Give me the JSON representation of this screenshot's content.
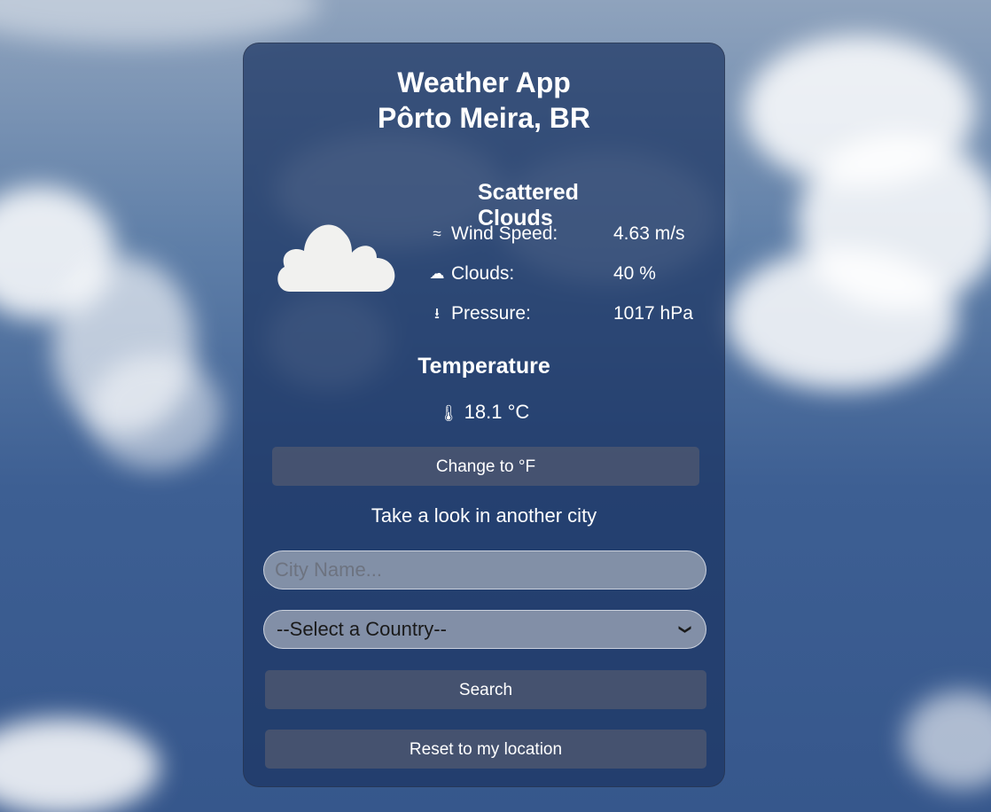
{
  "app": {
    "title": "Weather App",
    "location": "Pôrto Meira, BR"
  },
  "weather": {
    "description": "Scattered Clouds",
    "icon": "scattered-clouds-icon",
    "stats": [
      {
        "icon": "wind-icon",
        "glyph": "≈",
        "label": "Wind Speed:",
        "value": "4.63 m/s"
      },
      {
        "icon": "cloud-icon",
        "glyph": "☁",
        "label": "Clouds:",
        "value": "40 %"
      },
      {
        "icon": "pressure-icon",
        "glyph": "⭳",
        "label": "Pressure:",
        "value": "1017 hPa"
      }
    ]
  },
  "temperature": {
    "title": "Temperature",
    "icon": "thermometer-icon",
    "glyph": "🌡",
    "value": "18.1 °C"
  },
  "controls": {
    "unit_toggle_label": "Change to °F",
    "another_city_text": "Take a look in another city",
    "city_placeholder": "City Name...",
    "country_selected": "--Select a Country--",
    "search_label": "Search",
    "reset_label": "Reset to my location"
  },
  "colors": {
    "card_background": "#1c3462",
    "button_background": "#4b5670",
    "text": "#ffffff"
  }
}
